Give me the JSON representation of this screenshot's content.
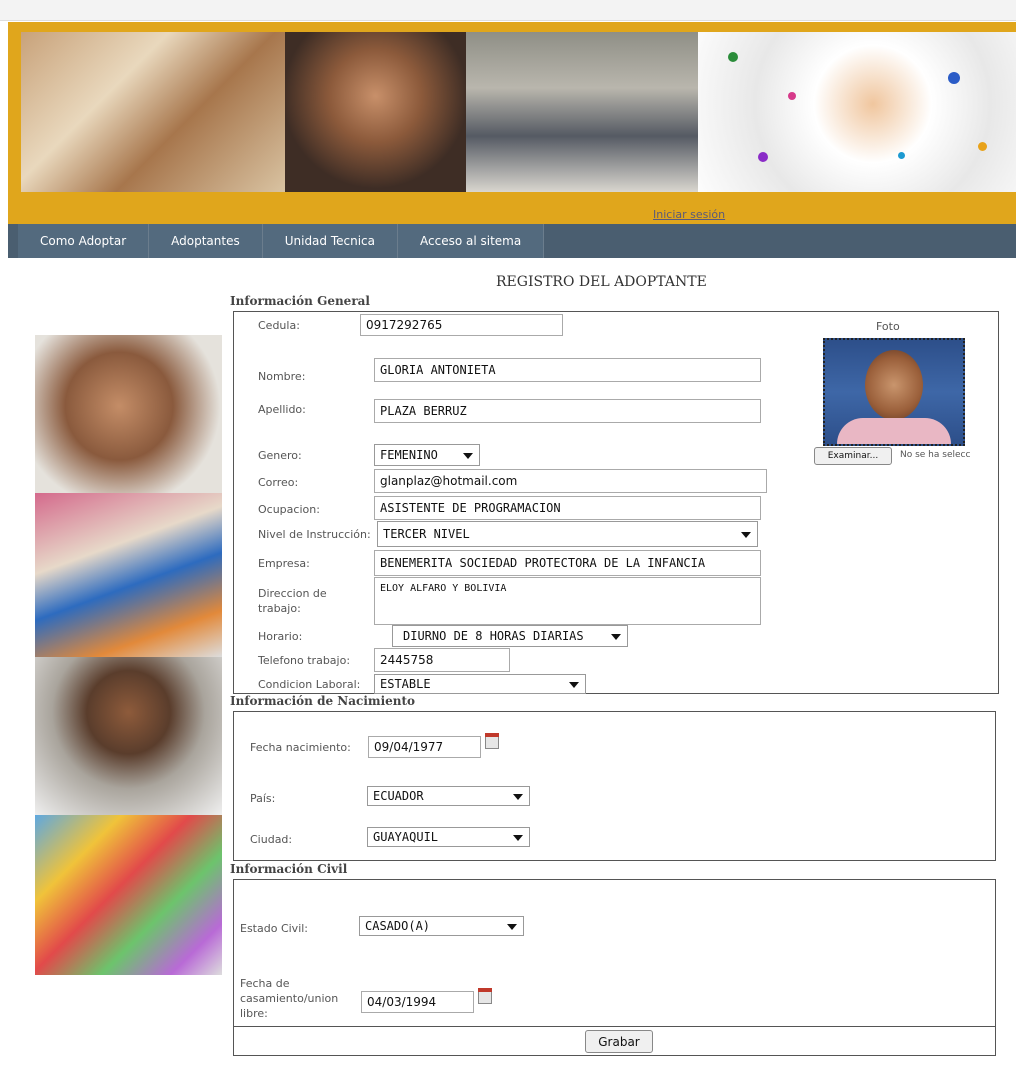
{
  "header": {
    "login_link": "Iniciar sesión"
  },
  "nav": {
    "items": [
      {
        "label": "Como Adoptar"
      },
      {
        "label": "Adoptantes"
      },
      {
        "label": "Unidad Tecnica"
      },
      {
        "label": "Acceso al sitema"
      }
    ]
  },
  "page": {
    "title": "REGISTRO DEL ADOPTANTE"
  },
  "general": {
    "section_title": "Información General",
    "cedula_label": "Cedula:",
    "cedula_value": "0917292765",
    "nombre_label": "Nombre:",
    "nombre_value": "GLORIA ANTONIETA",
    "apellido_label": "Apellido:",
    "apellido_value": "PLAZA BERRUZ",
    "genero_label": "Genero:",
    "genero_value": "FEMENINO",
    "correo_label": "Correo:",
    "correo_value": "glanplaz@hotmail.com",
    "ocupacion_label": "Ocupacion:",
    "ocupacion_value": "ASISTENTE DE PROGRAMACION",
    "nivel_label": "Nivel de Instrucción:",
    "nivel_value": "TERCER NIVEL",
    "empresa_label": "Empresa:",
    "empresa_value": "BENEMERITA SOCIEDAD PROTECTORA DE LA INFANCIA",
    "direccion_label": "Direccion de trabajo:",
    "direccion_value": "ELOY ALFARO Y BOLIVIA",
    "horario_label": "Horario:",
    "horario_value": "DIURNO DE 8 HORAS DIARIAS",
    "telefono_label": "Telefono trabajo:",
    "telefono_value": "2445758",
    "condicion_label": "Condicion Laboral:",
    "condicion_value": "ESTABLE",
    "foto_label": "Foto",
    "examinar_label": "Examinar...",
    "file_status": "No se ha selecc"
  },
  "nacimiento": {
    "section_title": "Información de Nacimiento",
    "fecha_label": "Fecha nacimiento:",
    "fecha_value": "09/04/1977",
    "pais_label": "País:",
    "pais_value": "ECUADOR",
    "ciudad_label": "Ciudad:",
    "ciudad_value": "GUAYAQUIL"
  },
  "civil": {
    "section_title": "Información Civil",
    "estado_label": "Estado Civil:",
    "estado_value": "CASADO(A)",
    "fecha_label": "Fecha de casamiento/union libre:",
    "fecha_value": "04/03/1994"
  },
  "actions": {
    "grabar_label": "Grabar"
  },
  "colors": {
    "banner": "#e0a61c",
    "nav": "#4a5e70",
    "accent": "#c0392b"
  }
}
